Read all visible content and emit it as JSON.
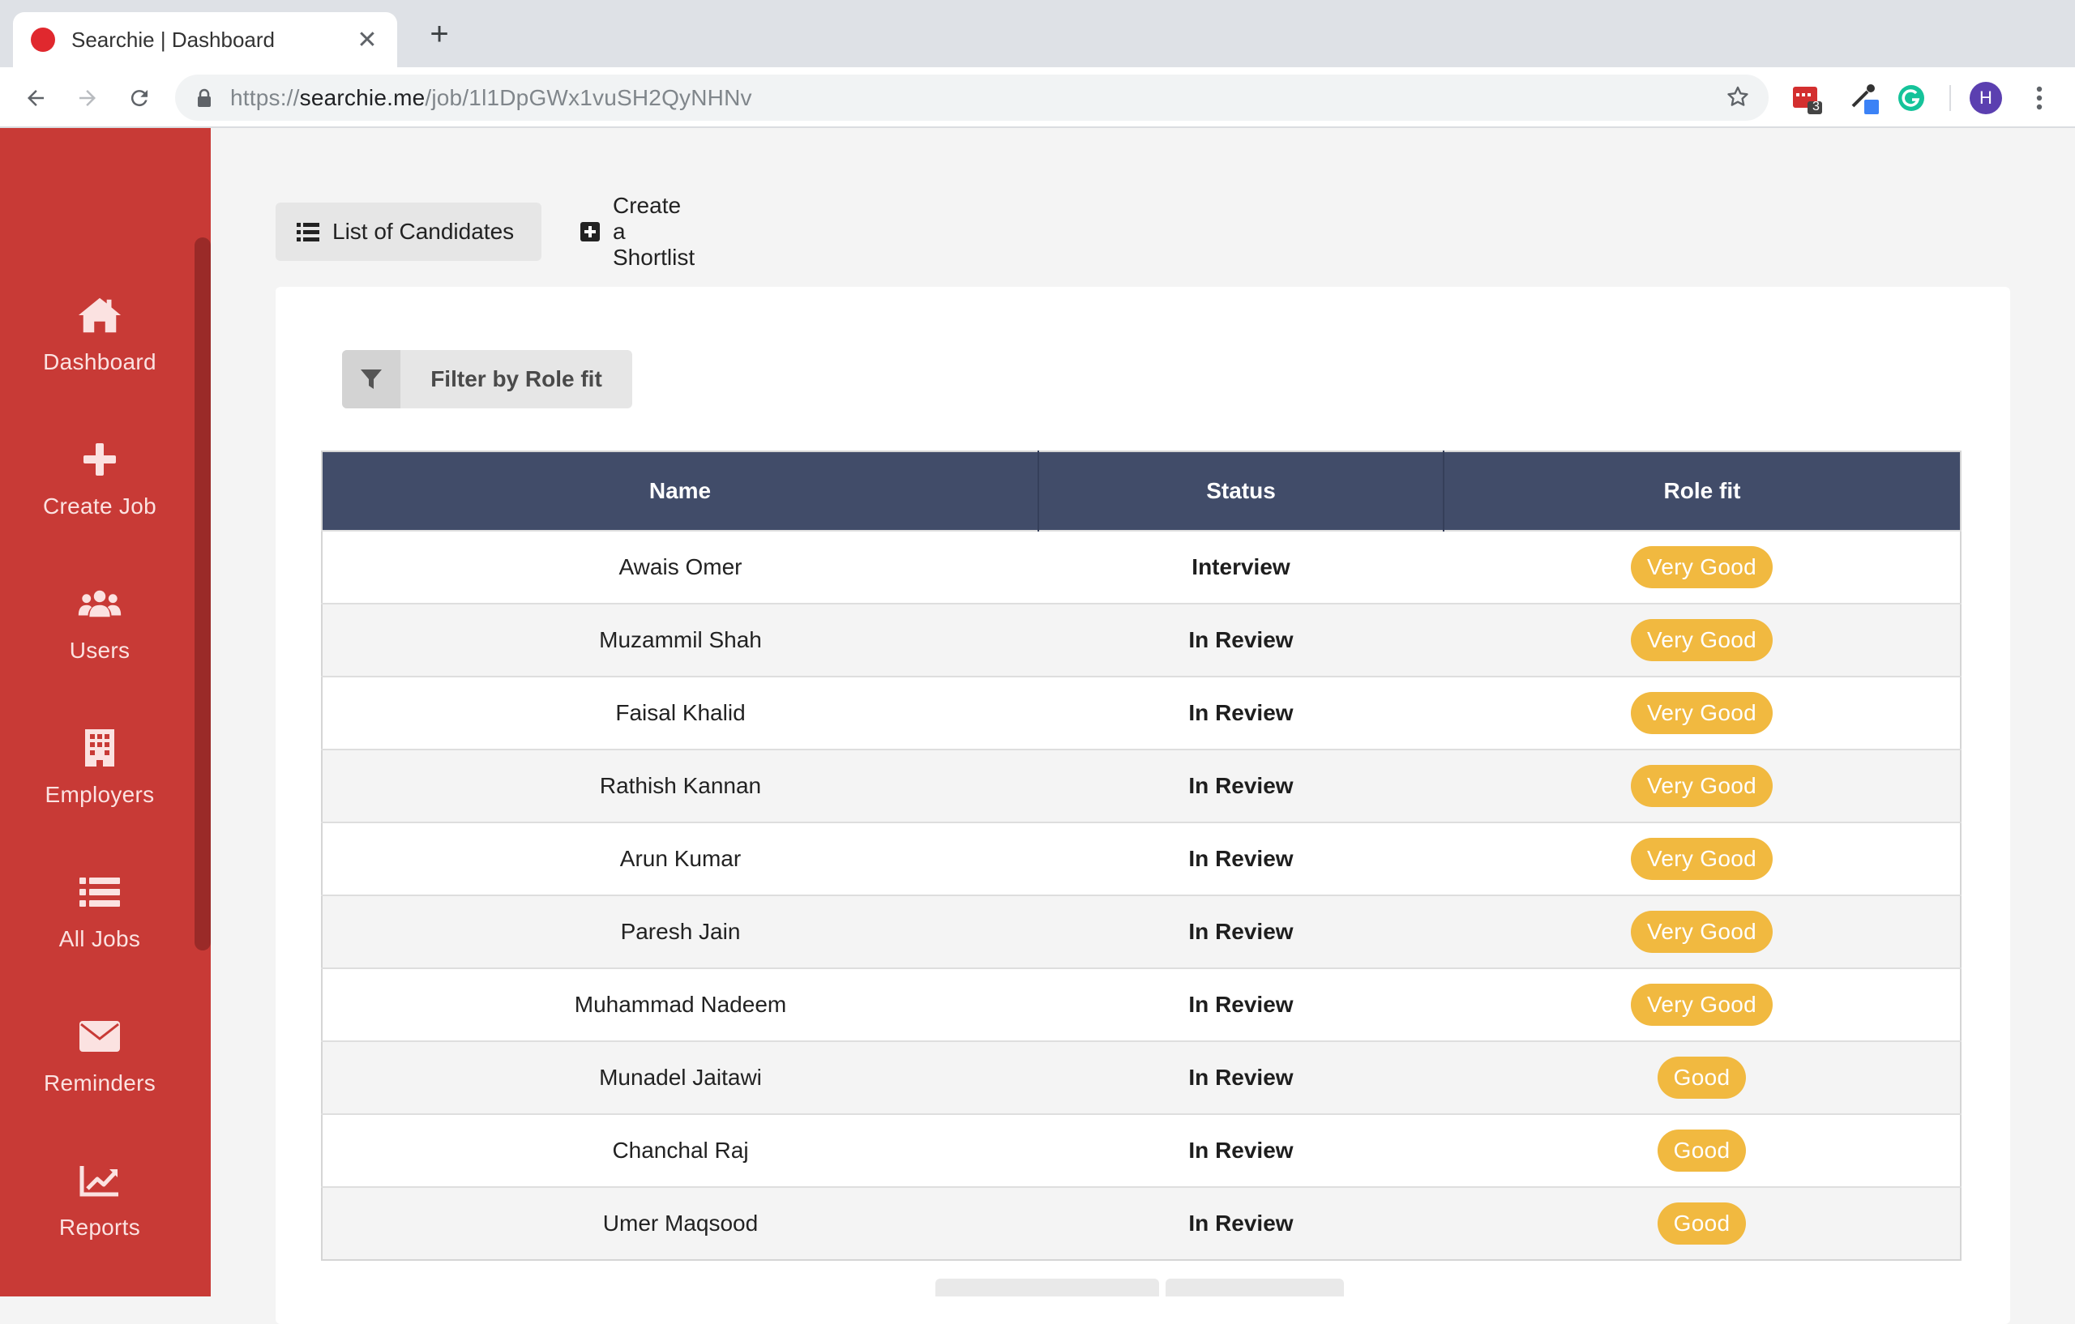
{
  "browser": {
    "tab_title": "Searchie | Dashboard",
    "tab_close": "✕",
    "new_tab": "+",
    "url_prefix": "https://",
    "url_host": "searchie.me",
    "url_path": "/job/1l1DpGWx1vuSH2QyNHNv",
    "ext_badge_count": "3",
    "profile_initial": "H"
  },
  "sidebar": {
    "items": [
      {
        "label": "Dashboard",
        "icon": "home-icon"
      },
      {
        "label": "Create Job",
        "icon": "plus-icon"
      },
      {
        "label": "Users",
        "icon": "users-icon"
      },
      {
        "label": "Employers",
        "icon": "building-icon"
      },
      {
        "label": "All Jobs",
        "icon": "list-icon"
      },
      {
        "label": "Reminders",
        "icon": "envelope-icon"
      },
      {
        "label": "Reports",
        "icon": "chart-line-icon"
      }
    ]
  },
  "page_tabs": [
    {
      "label": "List of Candidates",
      "icon": "list-icon",
      "active": true
    },
    {
      "label": "Create a Shortlist",
      "icon": "plus-square-icon",
      "active": false
    }
  ],
  "filter": {
    "label": "Filter by Role fit",
    "icon": "filter-icon"
  },
  "table": {
    "headers": [
      "Name",
      "Status",
      "Role fit"
    ],
    "rows": [
      {
        "name": "Awais Omer",
        "status": "Interview",
        "fit": "Very Good"
      },
      {
        "name": "Muzammil Shah",
        "status": "In Review",
        "fit": "Very Good"
      },
      {
        "name": "Faisal Khalid",
        "status": "In Review",
        "fit": "Very Good"
      },
      {
        "name": "Rathish Kannan",
        "status": "In Review",
        "fit": "Very Good"
      },
      {
        "name": "Arun Kumar",
        "status": "In Review",
        "fit": "Very Good"
      },
      {
        "name": "Paresh Jain",
        "status": "In Review",
        "fit": "Very Good"
      },
      {
        "name": "Muhammad Nadeem",
        "status": "In Review",
        "fit": "Very Good"
      },
      {
        "name": "Munadel Jaitawi",
        "status": "In Review",
        "fit": "Good"
      },
      {
        "name": "Chanchal Raj",
        "status": "In Review",
        "fit": "Good"
      },
      {
        "name": "Umer Maqsood",
        "status": "In Review",
        "fit": "Good"
      }
    ]
  },
  "colors": {
    "sidebar_bg": "#c83a36",
    "table_header_bg": "#414c69",
    "badge_bg": "#f1b940"
  }
}
